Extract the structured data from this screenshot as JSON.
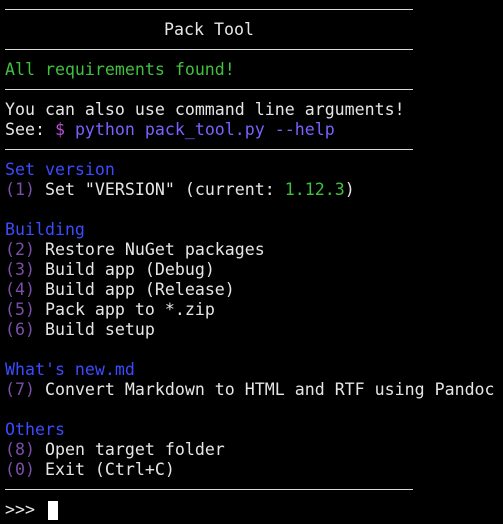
{
  "title": "Pack Tool",
  "status": "All requirements found!",
  "hint": {
    "line1": "You can also use command line arguments!",
    "see_label": "See: ",
    "dollar": "$",
    "command": " python pack_tool.py --help"
  },
  "sections": {
    "set_version": {
      "heading": "Set version",
      "items": [
        {
          "key": "(1)",
          "label": " Set \"VERSION\" (current: ",
          "value": "1.12.3",
          "suffix": ")"
        }
      ]
    },
    "building": {
      "heading": "Building",
      "items": [
        {
          "key": "(2)",
          "label": " Restore NuGet packages"
        },
        {
          "key": "(3)",
          "label": " Build app (Debug)"
        },
        {
          "key": "(4)",
          "label": " Build app (Release)"
        },
        {
          "key": "(5)",
          "label": " Pack app to *.zip"
        },
        {
          "key": "(6)",
          "label": " Build setup"
        }
      ]
    },
    "whats_new": {
      "heading": "What's new.md",
      "items": [
        {
          "key": "(7)",
          "label": " Convert Markdown to HTML and RTF using Pandoc"
        }
      ]
    },
    "others": {
      "heading": "Others",
      "items": [
        {
          "key": "(8)",
          "label": " Open target folder"
        },
        {
          "key": "(0)",
          "label": " Exit (Ctrl+C)"
        }
      ]
    }
  },
  "prompt": ">>>",
  "colors": {
    "background": "#000000",
    "text": "#e6e6e6",
    "success": "#3fc13f",
    "heading": "#3b4bff",
    "key": "#7a4fa8",
    "command": "#7c60ff",
    "dollar": "#b84fd4"
  }
}
